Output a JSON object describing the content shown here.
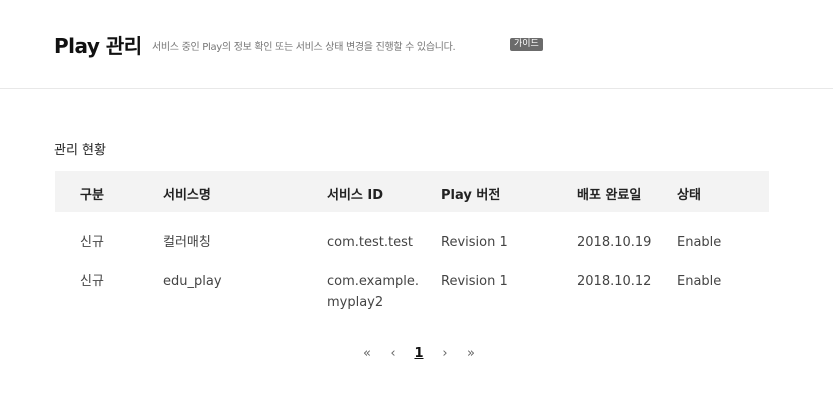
{
  "header": {
    "title": "Play 관리",
    "description": "서비스 중인 Play의 정보 확인 또는 서비스 상태 변경을 진행할 수 있습니다.",
    "guide_label": "가이드"
  },
  "section": {
    "title": "관리 현황"
  },
  "table": {
    "columns": [
      "구분",
      "서비스명",
      "서비스 ID",
      "Play 버전",
      "배포 완료일",
      "상태"
    ],
    "rows": [
      {
        "type": "신규",
        "service_name": "컬러매칭",
        "service_id": "com.test.test",
        "play_version": "Revision 1",
        "deploy_date": "2018.10.19",
        "status": "Enable"
      },
      {
        "type": "신규",
        "service_name": "edu_play",
        "service_id_line1": "com.example.",
        "service_id_line2": "myplay2",
        "play_version": "Revision 1",
        "deploy_date": "2018.10.12",
        "status": "Enable"
      }
    ]
  },
  "pagination": {
    "first": "«",
    "prev": "‹",
    "current_page": "1",
    "next": "›",
    "last": "»"
  }
}
